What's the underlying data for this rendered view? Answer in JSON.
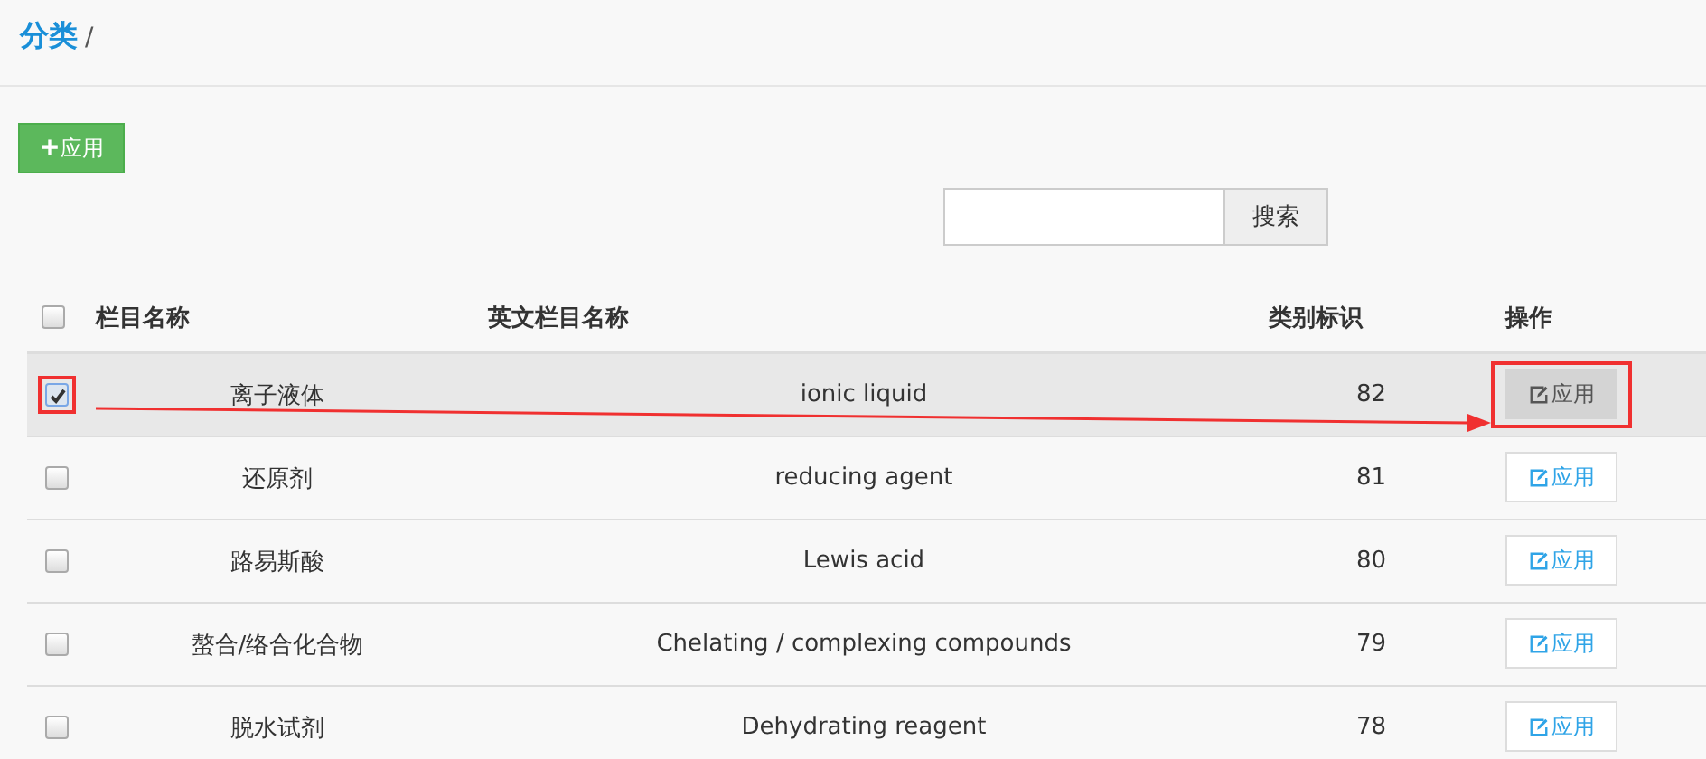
{
  "breadcrumb": {
    "title": "分类",
    "separator": "/"
  },
  "add_button": {
    "icon": "+",
    "label": "应用"
  },
  "search": {
    "button": "搜索"
  },
  "table": {
    "columns": [
      "栏目名称",
      "英文栏目名称",
      "类别标识",
      "操作"
    ],
    "header_checked": false,
    "rows": [
      {
        "name": "离子液体",
        "english": "ionic liquid",
        "id": "82",
        "action": "应用",
        "checked": true,
        "selected": true
      },
      {
        "name": "还原剂",
        "english": "reducing agent",
        "id": "81",
        "action": "应用",
        "checked": false,
        "selected": false
      },
      {
        "name": "路易斯酸",
        "english": "Lewis acid",
        "id": "80",
        "action": "应用",
        "checked": false,
        "selected": false
      },
      {
        "name": "螯合/络合化合物",
        "english": "Chelating / complexing compounds",
        "id": "79",
        "action": "应用",
        "checked": false,
        "selected": false
      },
      {
        "name": "脱水试剂",
        "english": "Dehydrating reagent",
        "id": "78",
        "action": "应用",
        "checked": false,
        "selected": false
      }
    ]
  }
}
